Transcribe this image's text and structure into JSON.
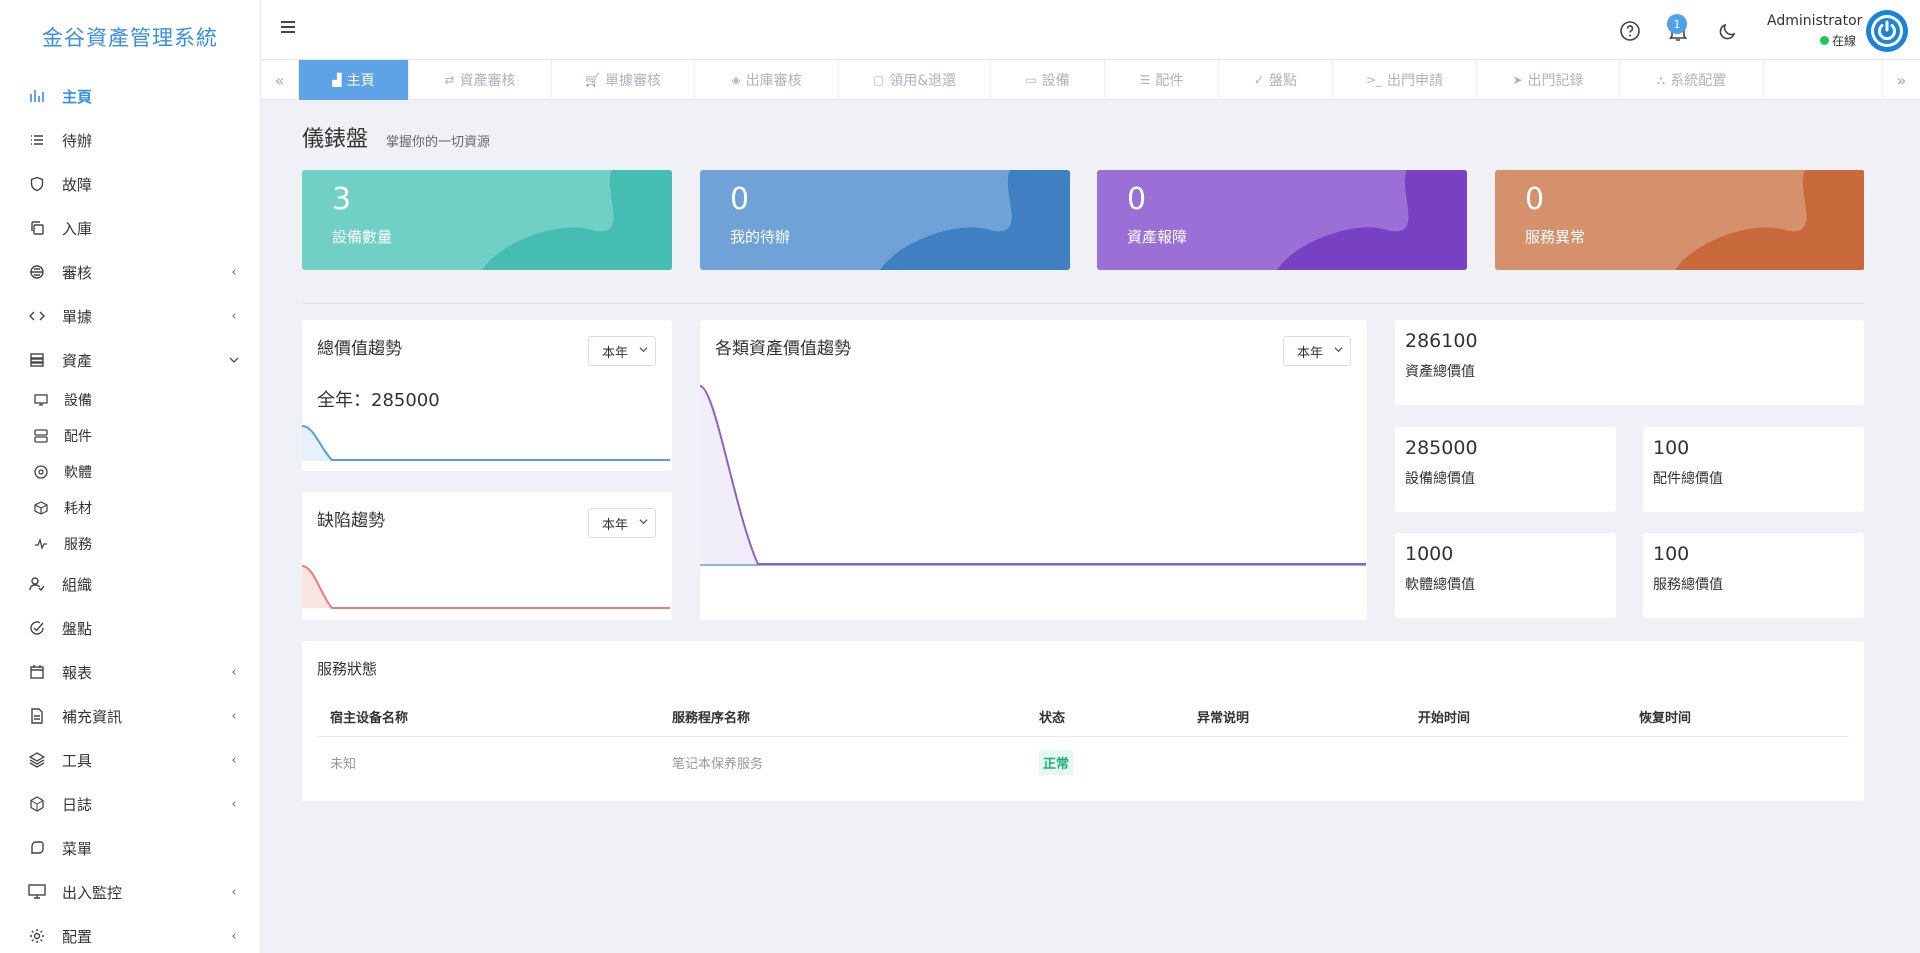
{
  "app": {
    "title": "金谷資產管理系統"
  },
  "sidebar": {
    "items": [
      {
        "label": "主頁",
        "icon": "bar-chart-icon",
        "active": true
      },
      {
        "label": "待辦",
        "icon": "list-icon"
      },
      {
        "label": "故障",
        "icon": "shield-icon"
      },
      {
        "label": "入庫",
        "icon": "copy-icon"
      },
      {
        "label": "審核",
        "icon": "audit-icon",
        "arrow": "‹"
      },
      {
        "label": "單據",
        "icon": "code-icon",
        "arrow": "‹"
      },
      {
        "label": "資產",
        "icon": "server-icon",
        "arrow": "⌄"
      },
      {
        "label": "組織",
        "icon": "user-check-icon"
      },
      {
        "label": "盤點",
        "icon": "check-circle-icon"
      },
      {
        "label": "報表",
        "icon": "calendar-icon",
        "arrow": "‹"
      },
      {
        "label": "補充資訊",
        "icon": "file-icon",
        "arrow": "‹"
      },
      {
        "label": "工具",
        "icon": "layers-icon",
        "arrow": "‹"
      },
      {
        "label": "日誌",
        "icon": "hexagon-icon",
        "arrow": "‹"
      },
      {
        "label": "菜單",
        "icon": "chat-icon"
      },
      {
        "label": "出入監控",
        "icon": "monitor-icon",
        "arrow": "‹"
      },
      {
        "label": "配置",
        "icon": "gear-icon",
        "arrow": "‹"
      }
    ],
    "asset_sub": [
      {
        "label": "設備",
        "icon": "monitor-icon"
      },
      {
        "label": "配件",
        "icon": "server-icon"
      },
      {
        "label": "軟體",
        "icon": "disc-icon"
      },
      {
        "label": "耗材",
        "icon": "cube-icon"
      },
      {
        "label": "服務",
        "icon": "activity-icon"
      }
    ]
  },
  "header": {
    "notification_count": "1",
    "user_name": "Administrator",
    "user_status": "在線"
  },
  "tabs": [
    {
      "label": "主頁",
      "active": true,
      "icon": "▟"
    },
    {
      "label": "資產審核",
      "icon": "⇄"
    },
    {
      "label": "單據審核",
      "icon": "🛒"
    },
    {
      "label": "出庫審核",
      "icon": "◈"
    },
    {
      "label": "領用&退還",
      "icon": "▢"
    },
    {
      "label": "設備",
      "icon": "▭"
    },
    {
      "label": "配件",
      "icon": "☰"
    },
    {
      "label": "盤點",
      "icon": "✓"
    },
    {
      "label": "出門申請",
      "icon": ">_"
    },
    {
      "label": "出門記錄",
      "icon": "➤"
    },
    {
      "label": "系統配置",
      "icon": "⛬"
    }
  ],
  "dashboard": {
    "title": "儀錶盤",
    "subtitle": "掌握你的一切資源"
  },
  "stat_cards": [
    {
      "value": "3",
      "label": "設備數量",
      "color": "#70d0c6",
      "accent": "#45bdb1"
    },
    {
      "value": "0",
      "label": "我的待辦",
      "color": "#6fa3d7",
      "accent": "#3f80c3"
    },
    {
      "value": "0",
      "label": "資產報障",
      "color": "#9b70d6",
      "accent": "#7841c3"
    },
    {
      "value": "0",
      "label": "服務異常",
      "color": "#d5906c",
      "accent": "#c96a3d"
    }
  ],
  "panels": {
    "total_value": {
      "title": "總價值趨勢",
      "select": "本年",
      "summary": "全年：285000"
    },
    "defect": {
      "title": "缺陷趨勢",
      "select": "本年"
    },
    "category": {
      "title": "各類資產價值趨勢",
      "select": "本年"
    }
  },
  "kpis": [
    {
      "value": "286100",
      "label": "資產總價值"
    },
    {
      "value": "285000",
      "label": "設備總價值"
    },
    {
      "value": "100",
      "label": "配件總價值"
    },
    {
      "value": "1000",
      "label": "軟體總價值"
    },
    {
      "value": "100",
      "label": "服務總價值"
    }
  ],
  "service_status": {
    "title": "服務狀態",
    "headers": [
      "宿主设备名称",
      "服務程序名称",
      "状态",
      "异常说明",
      "开始时间",
      "恢复时间"
    ],
    "rows": [
      {
        "host": "未知",
        "service": "笔记本保养服务",
        "status": "正常",
        "desc": "",
        "start": "",
        "recover": ""
      }
    ]
  }
}
